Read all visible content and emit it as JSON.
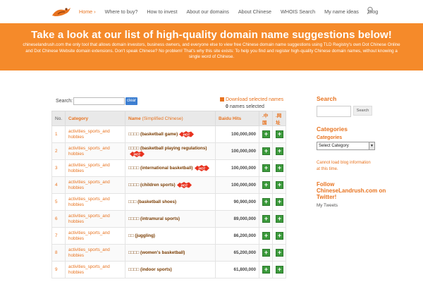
{
  "nav": {
    "items": [
      {
        "label": "Home",
        "active": true,
        "chevron": "›"
      },
      {
        "label": "Where to buy?"
      },
      {
        "label": "How to invest"
      },
      {
        "label": "About our domains"
      },
      {
        "label": "About Chinese"
      },
      {
        "label": "WHOIS Search"
      },
      {
        "label": "My name ideas"
      },
      {
        "label": "Blog"
      }
    ]
  },
  "hero": {
    "title": "Take a look at our list of high-quality domain name suggestions below!",
    "text": "chineselandrush.com the only tool that allows domain investors, business owners, and everyone else to view free Chinese domain name suggestions using TLD Registry's own Dot Chinese Online and Dot Chinese Website domain extensions. Don't speak Chinese? No problem! That's why this site exists: To help you find and register high-quality Chinese domain names, without knowing a single word of Chinese."
  },
  "toolbar": {
    "search_label": "Search:",
    "search_value": "",
    "clear_label": "clear",
    "download_label": "Download selected names",
    "selected_count": "0",
    "selected_suffix": "names selected"
  },
  "table": {
    "headers": {
      "num": "No.",
      "category": "Category",
      "name": "Name",
      "name_sub": "(Simplified Chinese)",
      "hits": "Baidu Hits",
      "col1": ".中国",
      "col2": ".网址"
    },
    "rows": [
      {
        "num": "1",
        "category": "activities_sports_and hobbies",
        "cn": "□□□□",
        "en": "(basketball game)",
        "hot": true,
        "hits": "100,000,000"
      },
      {
        "num": "2",
        "category": "activities_sports_and hobbies",
        "cn": "□□□□",
        "en": "(basketball playing regulations)",
        "hot": true,
        "hits": "100,000,000"
      },
      {
        "num": "3",
        "category": "activities_sports_and hobbies",
        "cn": "□□□□",
        "en": "(international basketball)",
        "hot": true,
        "hits": "100,000,000"
      },
      {
        "num": "4",
        "category": "activities_sports_and hobbies",
        "cn": "□□□□",
        "en": "(children sports)",
        "hot": true,
        "hits": "100,000,000"
      },
      {
        "num": "5",
        "category": "activities_sports_and hobbies",
        "cn": "□□□",
        "en": "(basketball shoes)",
        "hot": false,
        "hits": "90,900,000"
      },
      {
        "num": "6",
        "category": "activities_sports_and hobbies",
        "cn": "□□□□",
        "en": "(intramural sports)",
        "hot": false,
        "hits": "89,000,000"
      },
      {
        "num": "7",
        "category": "activities_sports_and hobbies",
        "cn": "□□",
        "en": "(juggling)",
        "hot": false,
        "hits": "86,200,000"
      },
      {
        "num": "8",
        "category": "activities_sports_and hobbies",
        "cn": "□□□□",
        "en": "(women's basketball)",
        "hot": false,
        "hits": "65,200,000"
      },
      {
        "num": "9",
        "category": "activities_sports_and hobbies",
        "cn": "□□□□",
        "en": "(indoor sports)",
        "hot": false,
        "hits": "61,800,000"
      }
    ],
    "hot_label": "HOT",
    "add_label": "+"
  },
  "sidebar": {
    "search_heading": "Search",
    "search_button": "Search",
    "categories_heading": "Categories",
    "categories_sub": "Categories",
    "select_value": "Select Category",
    "blog_error": "Cannot load blog information at this time.",
    "follow_heading": "Follow ChineseLandrush.com on Twitter!",
    "tweets": "My Tweets"
  },
  "colors": {
    "accent": "#e8731f",
    "hero_bg": "#f58a2a",
    "add_button": "#3b9a3b",
    "clear_button": "#3d7fd1"
  }
}
